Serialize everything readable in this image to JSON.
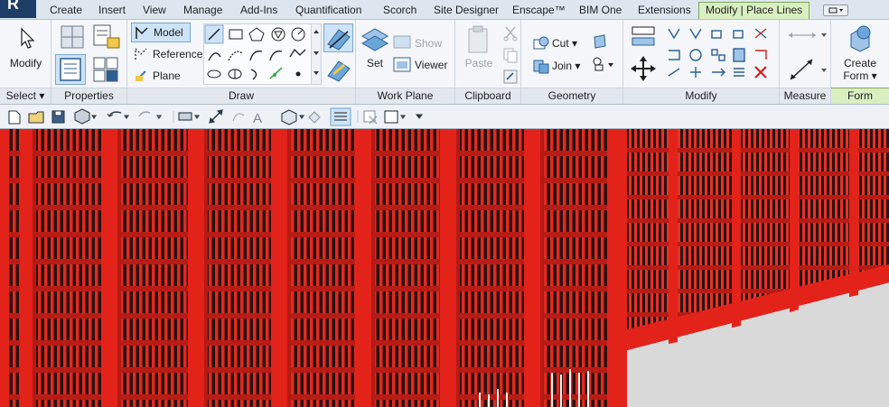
{
  "tabs": {
    "items": [
      "Create",
      "Insert",
      "View",
      "Manage",
      "Add-Ins",
      "Quantification",
      "Scorch",
      "Site Designer",
      "Enscape™",
      "BIM One",
      "Extensions"
    ],
    "active": "Modify | Place Lines"
  },
  "ribbon": {
    "select": {
      "label": "Modify",
      "panel": "Select ▾"
    },
    "properties": {
      "panel": "Properties"
    },
    "draw": {
      "model": "Model",
      "reference": "Reference",
      "plane": "Plane",
      "panel": "Draw"
    },
    "work_plane": {
      "set": "Set",
      "show": "Show",
      "viewer": "Viewer",
      "panel": "Work Plane"
    },
    "clipboard": {
      "paste": "Paste",
      "panel": "Clipboard"
    },
    "geometry": {
      "cut": "Cut ▾",
      "join": "Join ▾",
      "panel": "Geometry"
    },
    "modify": {
      "panel": "Modify"
    },
    "measure": {
      "panel": "Measure"
    },
    "form": {
      "create_form_line1": "Create",
      "create_form_line2": "Form ▾",
      "panel": "Form"
    }
  },
  "colors": {
    "accent": "#d9efc0",
    "facade_red": "#e3231a",
    "ground": "#d8d8d8",
    "ribbon_bg": "#f4f6f9"
  }
}
